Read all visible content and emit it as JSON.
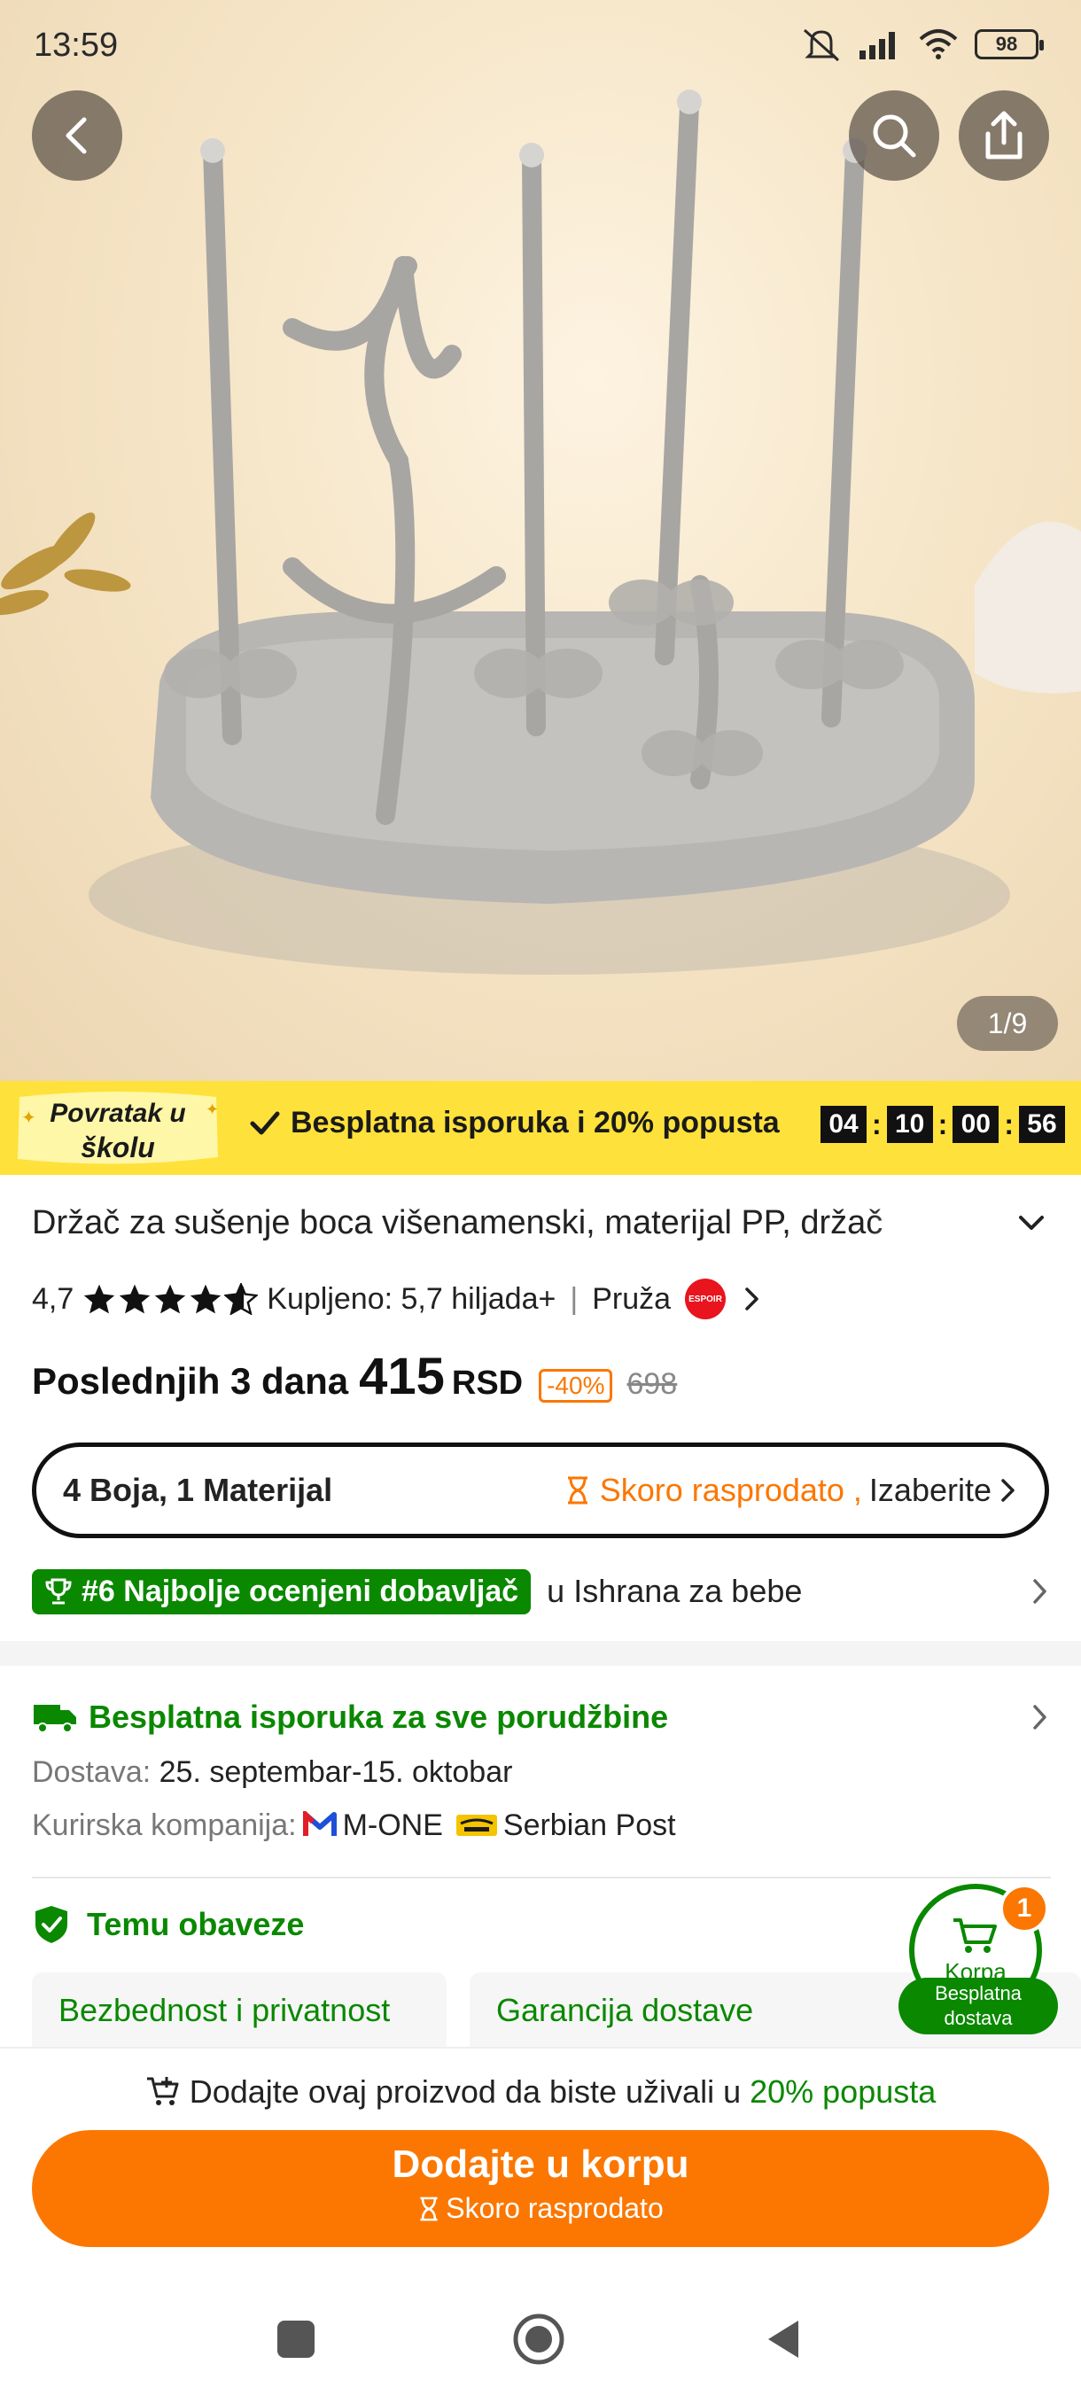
{
  "status_bar": {
    "time": "13:59",
    "battery": "98"
  },
  "gallery": {
    "counter": "1/9"
  },
  "promo": {
    "badge_line1": "Povratak u",
    "badge_line2": "školu",
    "text": "Besplatna isporuka i 20% popusta",
    "timer": [
      "04",
      "10",
      "00",
      "56"
    ]
  },
  "product": {
    "title": "Držač za sušenje boca višenamenski, materijal PP, držač",
    "rating": "4,7",
    "sold": "Kupljeno: 5,7 hiljada+",
    "provided_by": "Pruža",
    "seller_logo_text": "ESPOIR",
    "price_label": "Poslednjih 3 dana",
    "price": "415",
    "currency": "RSD",
    "discount": "-40%",
    "old_price": "698"
  },
  "variant": {
    "summary": "4 Boja, 1 Materijal",
    "selling_fast": "Skoro rasprodato ,",
    "choose": "Izaberite"
  },
  "ranking": {
    "badge": "#6 Najbolje ocenjeni dobavljač",
    "category": "u Ishrana za bebe"
  },
  "shipping": {
    "title": "Besplatna isporuka za sve porudžbine",
    "delivery_label": "Dostava:",
    "delivery_value": "25. septembar-15. oktobar",
    "courier_label": "Kurirska kompanija:",
    "courier1": "M-ONE",
    "courier2": "Serbian Post"
  },
  "commitments": {
    "title": "Temu obaveze",
    "cards": [
      "Bezbednost i privatnost",
      "Garancija dostave"
    ]
  },
  "cart_fab": {
    "count": "1",
    "label": "Korpa",
    "free_line1": "Besplatna",
    "free_line2": "dostava"
  },
  "bottom": {
    "msg_prefix": "Dodajte ovaj proizvod da biste uživali u",
    "msg_highlight": "20% popusta",
    "add_label": "Dodajte u korpu",
    "add_sub": "Skoro rasprodato"
  },
  "colors": {
    "accent_orange": "#fb7701",
    "green": "#0a8800",
    "promo_yellow": "#ffe13b"
  }
}
